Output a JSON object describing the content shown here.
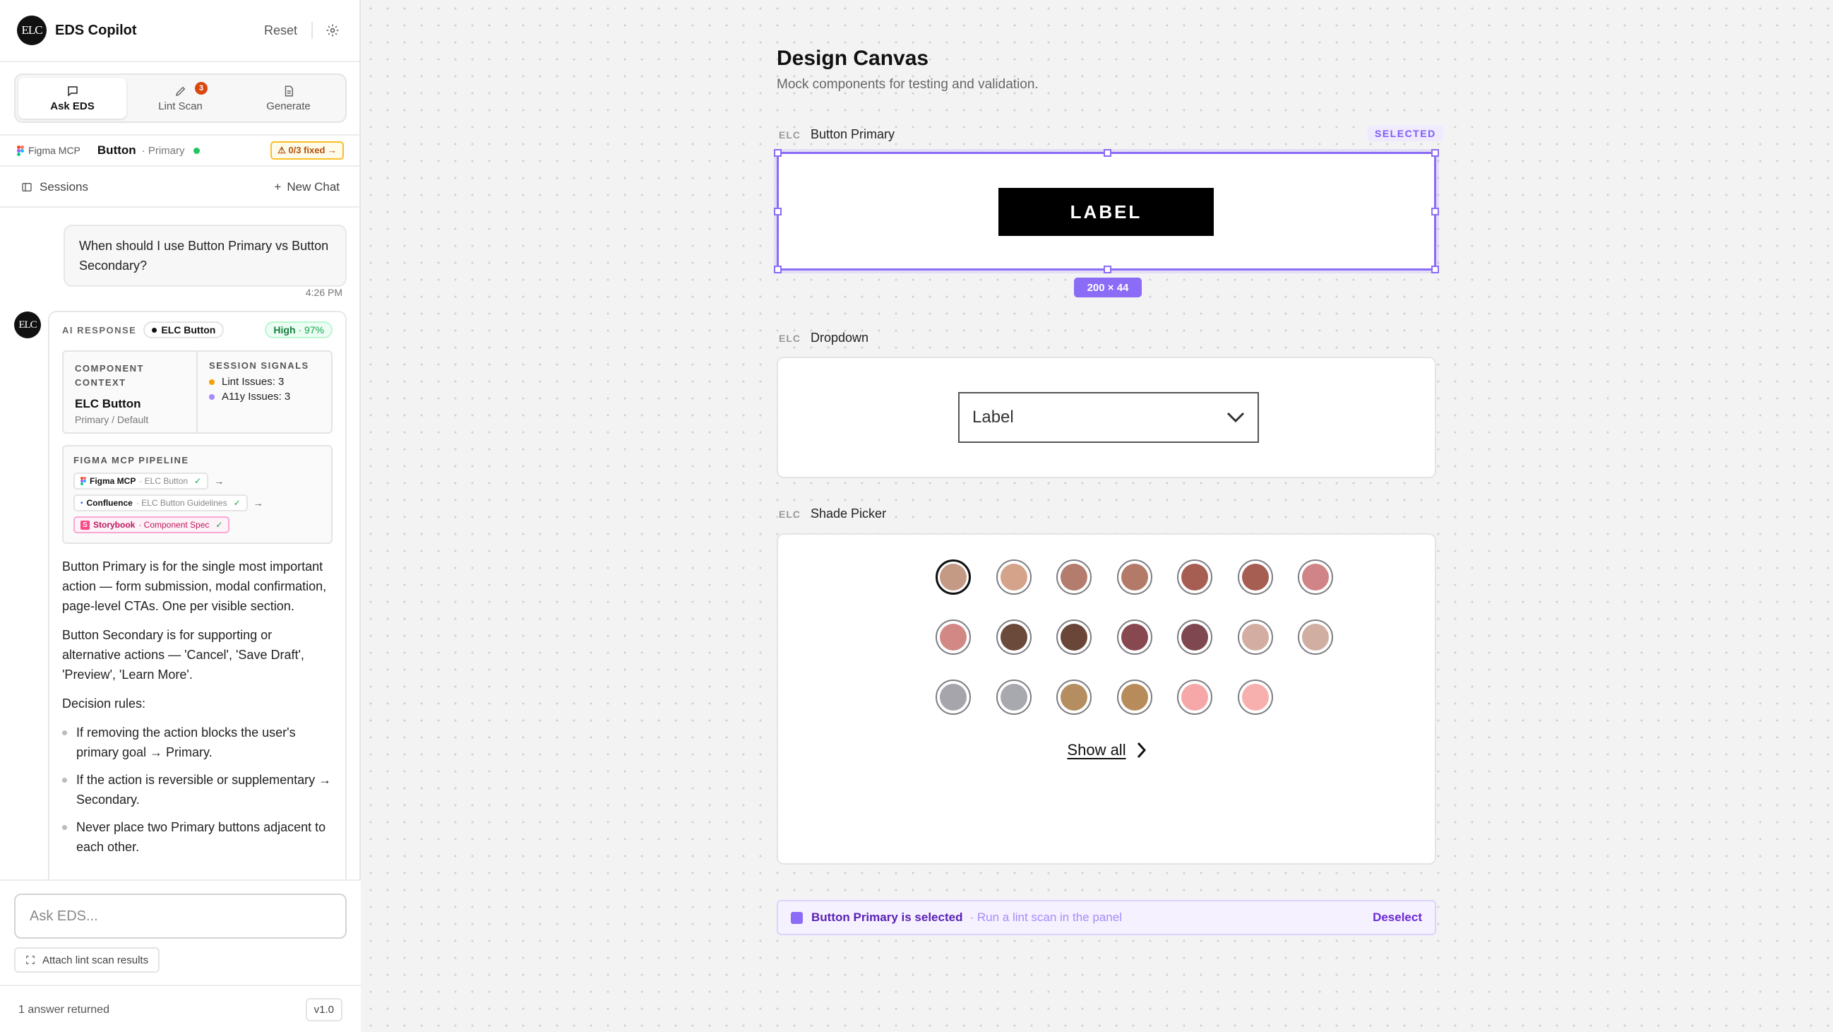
{
  "app": {
    "title": "EDS Copilot",
    "logo": "ELC",
    "reset_label": "Reset"
  },
  "tabs": [
    {
      "label": "Ask EDS",
      "icon": "chat-icon",
      "active": true
    },
    {
      "label": "Lint Scan",
      "icon": "pencil-icon",
      "badge": "3"
    },
    {
      "label": "Generate",
      "icon": "document-icon"
    }
  ],
  "context": {
    "source": "Figma MCP",
    "component": "Button",
    "variant": "· Primary",
    "status_color": "#22c55e",
    "fixed_badge": "⚠ 0/3 fixed →"
  },
  "sessions": {
    "label": "Sessions",
    "new_chat": "New Chat"
  },
  "user_message": {
    "text": "When should I use Button Primary vs Button Secondary?",
    "time": "4:26 PM"
  },
  "ai": {
    "avatar": "ELC",
    "label": "AI RESPONSE",
    "component_chip": "ELC Button",
    "confidence": "High",
    "confidence_pct": "· 97%",
    "component_context": {
      "label": "COMPONENT CONTEXT",
      "name": "ELC Button",
      "sub": "Primary / Default"
    },
    "session_signals": {
      "label": "SESSION SIGNALS",
      "items": [
        {
          "text": "Lint Issues: 3",
          "color": "#f59e0b"
        },
        {
          "text": "A11y Issues: 3",
          "color": "#a78bfa"
        }
      ]
    },
    "pipeline": {
      "label": "FIGMA MCP PIPELINE",
      "steps": [
        {
          "name": "Figma MCP",
          "sub": "· ELC Button"
        },
        {
          "name": "Confluence",
          "sub": "· ELC Button Guidelines"
        },
        {
          "name": "Storybook",
          "sub": "· Component Spec"
        }
      ]
    },
    "paragraphs": [
      "Button Primary is for the single most important action — form submission, modal confirmation, page-level CTAs. One per visible section.",
      "Button Secondary is for supporting or alternative actions — 'Cancel', 'Save Draft', 'Preview', 'Learn More'.",
      "Decision rules:"
    ],
    "rules": [
      "If removing the action blocks the user's primary goal → Primary.",
      "If the action is reversible or supplementary → Secondary.",
      "Never place two Primary buttons adjacent to each other."
    ]
  },
  "composer": {
    "placeholder": "Ask EDS...",
    "attach_label": "Attach lint scan results",
    "status": "1 answer returned",
    "version": "v1.0"
  },
  "canvas": {
    "title": "Design Canvas",
    "subtitle": "Mock components for testing and validation.",
    "elc_tag": "ELC",
    "button_section": {
      "name": "Button Primary",
      "selected_tag": "SELECTED",
      "button_label": "LABEL",
      "dimensions": "200 × 44"
    },
    "dropdown_section": {
      "name": "Dropdown",
      "value": "Label"
    },
    "shade_section": {
      "name": "Shade Picker",
      "show_all": "Show all",
      "selected_index": 0,
      "rows": [
        [
          "#c59a85",
          "#d4a38a",
          "#b47c6d",
          "#b47a68",
          "#a75e52",
          "#a65e52",
          "#d08487"
        ],
        [
          "#d28986",
          "#6b4a3c",
          "#694638",
          "#874850",
          "#7f4750",
          "#d3ada2",
          "#d1aea2"
        ],
        [
          "#a6a5ab",
          "#a8a9af",
          "#b48e60",
          "#b88c5a",
          "#f5a8a7",
          "#f7b0ae"
        ]
      ]
    },
    "selection_bar": {
      "text": "Button Primary is selected",
      "hint": "· Run a lint scan in the panel",
      "action": "Deselect"
    }
  },
  "colors": {
    "accent": "#8b6cf6",
    "primary_button": "#000000"
  }
}
